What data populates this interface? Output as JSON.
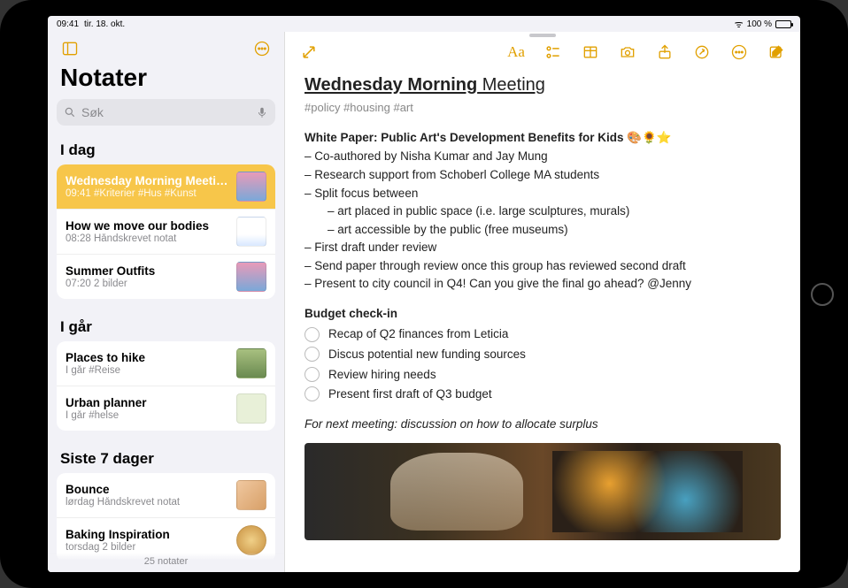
{
  "status": {
    "time": "09:41",
    "date": "tir. 18. okt.",
    "battery_pct": "100 %"
  },
  "sidebar": {
    "title": "Notater",
    "search_placeholder": "Søk",
    "footer": "25 notater",
    "sections": [
      {
        "header": "I dag",
        "notes": [
          {
            "title": "Wednesday Morning Meeting",
            "sub_time": "09:41",
            "sub_text": "#Kriterier #Hus #Kunst",
            "selected": true,
            "thumb": "thumb-photo"
          },
          {
            "title": "How we move our bodies",
            "sub_time": "08:28",
            "sub_text": "Håndskrevet notat",
            "selected": false,
            "thumb": "thumb-doc"
          },
          {
            "title": "Summer Outfits",
            "sub_time": "07:20",
            "sub_text": "2 bilder",
            "selected": false,
            "thumb": "thumb-photo"
          }
        ]
      },
      {
        "header": "I går",
        "notes": [
          {
            "title": "Places to hike",
            "sub_time": "I går",
            "sub_text": "#Reise",
            "selected": false,
            "thumb": "thumb-hike"
          },
          {
            "title": "Urban planner",
            "sub_time": "I går",
            "sub_text": "#helse",
            "selected": false,
            "thumb": "thumb-plan"
          }
        ]
      },
      {
        "header": "Siste 7 dager",
        "notes": [
          {
            "title": "Bounce",
            "sub_time": "lørdag",
            "sub_text": "Håndskrevet notat",
            "selected": false,
            "thumb": "thumb-bounce"
          },
          {
            "title": "Baking Inspiration",
            "sub_time": "torsdag",
            "sub_text": "2 bilder",
            "selected": false,
            "thumb": "thumb-bake"
          }
        ]
      }
    ]
  },
  "note": {
    "title_bold": "Wednesday Morning",
    "title_rest": " Meeting",
    "tags": "#policy #housing #art",
    "white_paper_heading": "White Paper: Public Art's Development Benefits for Kids 🎨🌻⭐",
    "lines": [
      "– Co-authored by Nisha Kumar and Jay Mung",
      "– Research support from Schoberl College MA students",
      "– Split focus between"
    ],
    "indented": [
      "– art placed in public space (i.e. large sculptures, murals)",
      "– art accessible by the public (free museums)"
    ],
    "lines2": [
      "– First draft under review",
      "– Send paper through review once this group has reviewed second draft",
      "– Present to city council in Q4! Can you give the final go ahead? @Jenny"
    ],
    "budget_heading": "Budget check-in",
    "checks": [
      "Recap of Q2 finances from Leticia",
      "Discus potential new funding sources",
      "Review hiring needs",
      "Present first draft of Q3 budget"
    ],
    "followup": "For next meeting: discussion on how to allocate surplus"
  }
}
